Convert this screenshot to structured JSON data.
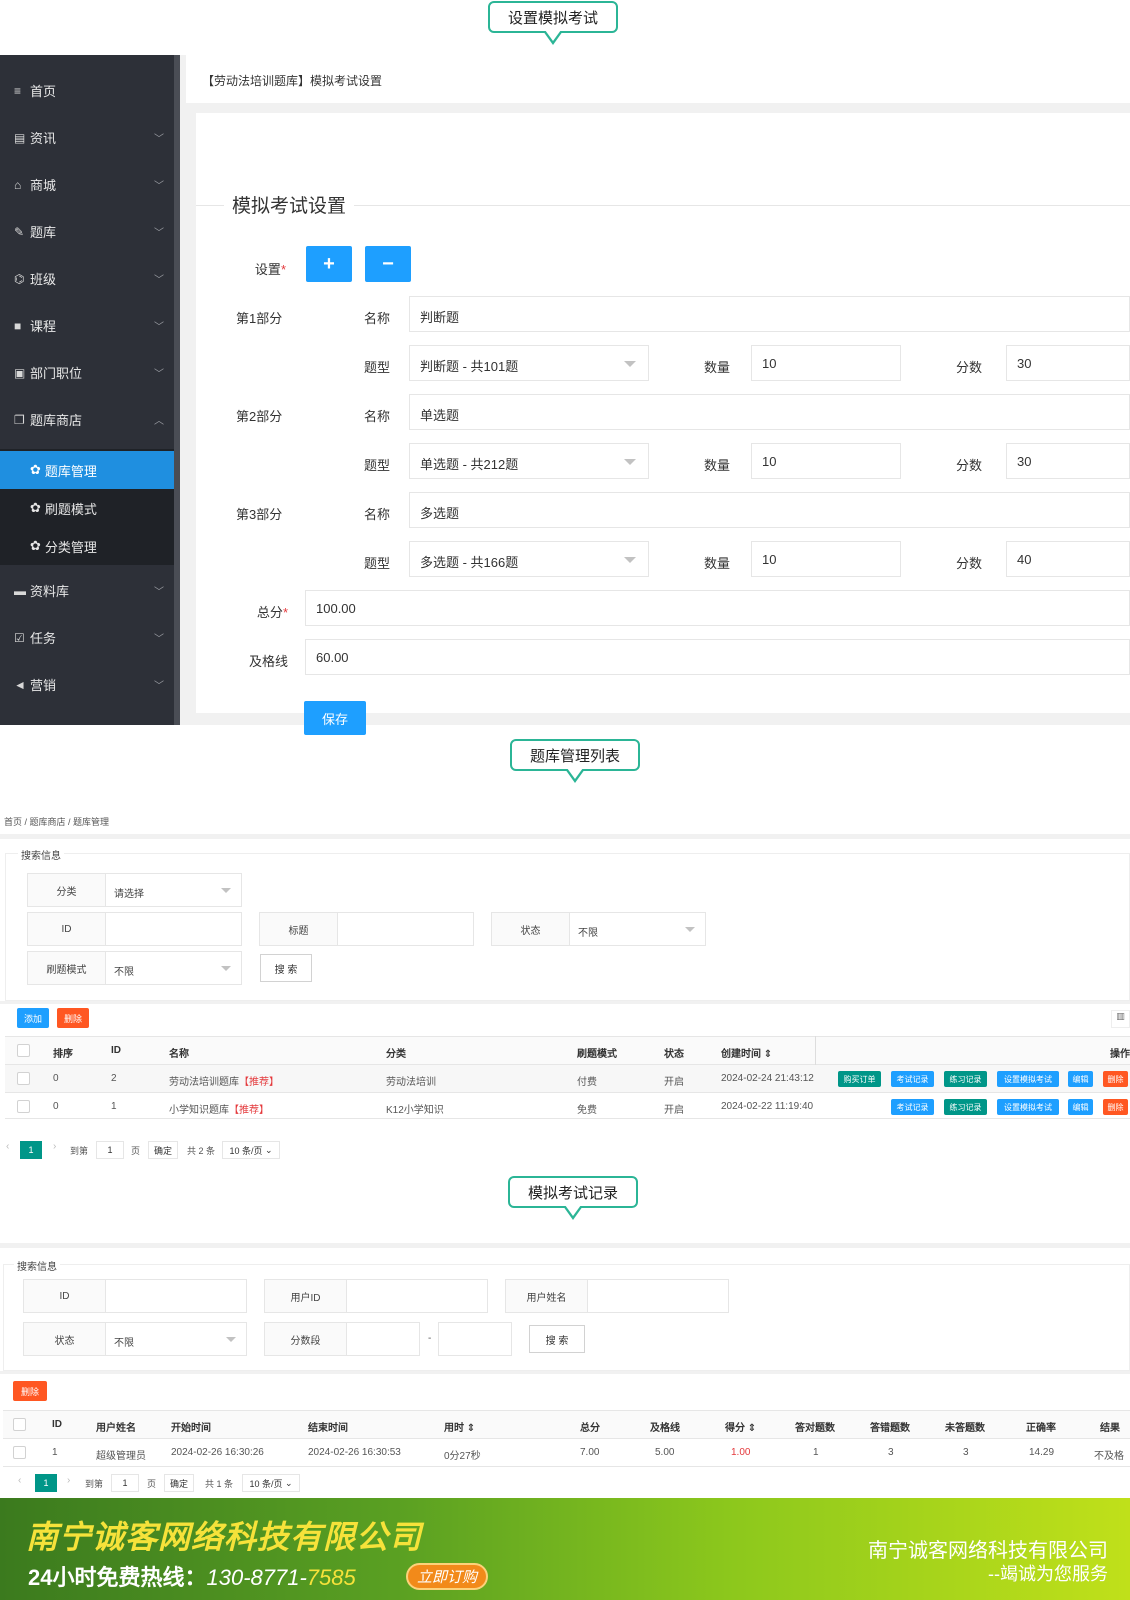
{
  "callouts": {
    "c1": "设置模拟考试",
    "c2": "题库管理列表",
    "c3": "模拟考试记录"
  },
  "sidebar": {
    "items": [
      {
        "icon": "≡",
        "label": "首页"
      },
      {
        "icon": "▤",
        "label": "资讯"
      },
      {
        "icon": "⌂",
        "label": "商城"
      },
      {
        "icon": "✎",
        "label": "题库"
      },
      {
        "icon": "⌬",
        "label": "班级"
      },
      {
        "icon": "■",
        "label": "课程"
      },
      {
        "icon": "▣",
        "label": "部门职位"
      },
      {
        "icon": "❐",
        "label": "题库商店"
      },
      {
        "icon": "▬",
        "label": "资料库"
      },
      {
        "icon": "☑",
        "label": "任务"
      },
      {
        "icon": "◄",
        "label": "营销"
      }
    ],
    "subitems": [
      {
        "icon": "✿",
        "label": "题库管理"
      },
      {
        "icon": "✿",
        "label": "刷题模式"
      },
      {
        "icon": "✿",
        "label": "分类管理"
      }
    ]
  },
  "settings": {
    "breadcrumb": "【劳动法培训题库】模拟考试设置",
    "legend": "模拟考试设置",
    "setting_label": "设置",
    "required_mark": "*",
    "add_btn": "+",
    "remove_btn": "−",
    "name_label": "名称",
    "type_label": "题型",
    "count_label": "数量",
    "score_label": "分数",
    "parts": [
      {
        "title": "第1部分",
        "name": "判断题",
        "type": "判断题 - 共101题",
        "count": "10",
        "score": "30"
      },
      {
        "title": "第2部分",
        "name": "单选题",
        "type": "单选题 - 共212题",
        "count": "10",
        "score": "30"
      },
      {
        "title": "第3部分",
        "name": "多选题",
        "type": "多选题 - 共166题",
        "count": "10",
        "score": "40"
      }
    ],
    "total_label": "总分",
    "total_value": "100.00",
    "pass_label": "及格线",
    "pass_value": "60.00",
    "save_btn": "保存"
  },
  "bank_list": {
    "breadcrumb": "首页  /  题库商店  /  题库管理",
    "search_legend": "搜索信息",
    "filters": {
      "category_label": "分类",
      "category_value": "请选择",
      "id_label": "ID",
      "title_label": "标题",
      "status_label": "状态",
      "status_value": "不限",
      "mode_label": "刷题模式",
      "mode_value": "不限",
      "search_btn": "搜 索"
    },
    "add_btn": "添加",
    "delete_btn": "删除",
    "columns": [
      "排序",
      "ID",
      "名称",
      "分类",
      "刷题模式",
      "状态",
      "创建时间 ⇕",
      "操作"
    ],
    "rows": [
      {
        "sort": "0",
        "id": "2",
        "name": "劳动法培训题库",
        "tag": "【推荐】",
        "category": "劳动法培训",
        "mode": "付费",
        "status": "开启",
        "created": "2024-02-24 21:43:12",
        "ops": [
          "购买订单",
          "考试记录",
          "练习记录",
          "设置模拟考试",
          "编辑",
          "删除"
        ]
      },
      {
        "sort": "0",
        "id": "1",
        "name": "小学知识题库",
        "tag": "【推荐】",
        "category": "K12小学知识",
        "mode": "免费",
        "status": "开启",
        "created": "2024-02-22 11:19:40",
        "ops": [
          "考试记录",
          "练习记录",
          "设置模拟考试",
          "编辑",
          "删除"
        ]
      }
    ],
    "pager": {
      "page": "1",
      "goto": "到第",
      "page_input": "1",
      "page_unit": "页",
      "confirm": "确定",
      "total": "共 2 条",
      "per_page": "10 条/页"
    }
  },
  "exam_records": {
    "search_legend": "搜索信息",
    "filters": {
      "id_label": "ID",
      "uid_label": "用户ID",
      "uname_label": "用户姓名",
      "status_label": "状态",
      "status_value": "不限",
      "score_label": "分数段",
      "dash": "-",
      "search_btn": "搜 索"
    },
    "delete_btn": "删除",
    "columns": [
      "ID",
      "用户姓名",
      "开始时间",
      "结束时间",
      "用时 ⇕",
      "总分",
      "及格线",
      "得分 ⇕",
      "答对题数",
      "答错题数",
      "未答题数",
      "正确率",
      "结果"
    ],
    "rows": [
      {
        "id": "1",
        "user": "超级管理员",
        "start": "2024-02-26 16:30:26",
        "end": "2024-02-26 16:30:53",
        "duration": "0分27秒",
        "total": "7.00",
        "pass": "5.00",
        "score": "1.00",
        "right": "1",
        "wrong": "3",
        "unanswered": "3",
        "rate": "14.29",
        "result": "不及格"
      }
    ],
    "pager": {
      "page": "1",
      "goto": "到第",
      "page_input": "1",
      "page_unit": "页",
      "confirm": "确定",
      "total": "共 1 条",
      "per_page": "10 条/页"
    }
  },
  "banner": {
    "company": "南宁诚客网络科技有限公司",
    "hotline_label": "24小时免费热线：",
    "hotline_number": "130-8771-",
    "hotline_tail": "7585",
    "order_btn": "立即订购",
    "right_company": "南宁诚客网络科技有限公司",
    "slogan": "--竭诚为您服务"
  },
  "colors": {
    "accent_blue": "#1e9fff",
    "teal": "#009688",
    "orange": "#ff5722",
    "callout_border": "#2bb596",
    "score_red": "#e4393c"
  }
}
